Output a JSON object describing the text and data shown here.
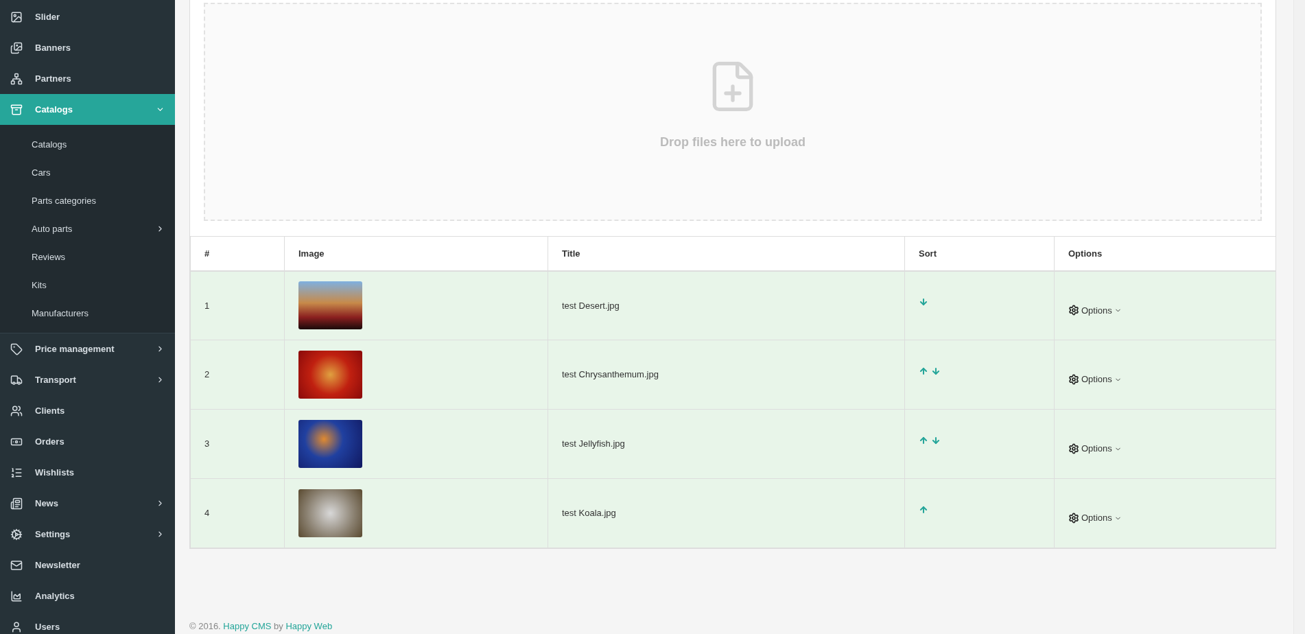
{
  "sidebar": {
    "items": [
      {
        "label": "Slider",
        "selected": false,
        "has_submenu": false
      },
      {
        "label": "Banners",
        "selected": false,
        "has_submenu": false
      },
      {
        "label": "Partners",
        "selected": false,
        "has_submenu": false
      },
      {
        "label": "Catalogs",
        "selected": true,
        "has_submenu": true,
        "expanded": true,
        "children": [
          {
            "label": "Catalogs",
            "has_submenu": false
          },
          {
            "label": "Cars",
            "has_submenu": false
          },
          {
            "label": "Parts categories",
            "has_submenu": false
          },
          {
            "label": "Auto parts",
            "has_submenu": true
          },
          {
            "label": "Reviews",
            "has_submenu": false
          },
          {
            "label": "Kits",
            "has_submenu": false
          },
          {
            "label": "Manufacturers",
            "has_submenu": false
          }
        ]
      },
      {
        "label": "Price management",
        "selected": false,
        "has_submenu": true
      },
      {
        "label": "Transport",
        "selected": false,
        "has_submenu": true
      },
      {
        "label": "Clients",
        "selected": false,
        "has_submenu": false
      },
      {
        "label": "Orders",
        "selected": false,
        "has_submenu": false
      },
      {
        "label": "Wishlists",
        "selected": false,
        "has_submenu": false
      },
      {
        "label": "News",
        "selected": false,
        "has_submenu": true
      },
      {
        "label": "Settings",
        "selected": false,
        "has_submenu": true
      },
      {
        "label": "Newsletter",
        "selected": false,
        "has_submenu": false
      },
      {
        "label": "Analytics",
        "selected": false,
        "has_submenu": false
      },
      {
        "label": "Users",
        "selected": false,
        "has_submenu": false
      }
    ]
  },
  "dropzone": {
    "message": "Drop files here to upload"
  },
  "table": {
    "columns": [
      "#",
      "Image",
      "Title",
      "Sort",
      "Options"
    ],
    "rows": [
      {
        "number": "1",
        "title": "test Desert.jpg",
        "sort_up": false,
        "sort_down": true,
        "options": "Options"
      },
      {
        "number": "2",
        "title": "test Chrysanthemum.jpg",
        "sort_up": true,
        "sort_down": true,
        "options": "Options"
      },
      {
        "number": "3",
        "title": "test Jellyfish.jpg",
        "sort_up": true,
        "sort_down": true,
        "options": "Options"
      },
      {
        "number": "4",
        "title": "test Koala.jpg",
        "sort_up": true,
        "sort_down": false,
        "options": "Options"
      }
    ]
  },
  "footer": {
    "copyright": "© 2016.",
    "cms_link": "Happy CMS",
    "by": "by",
    "author_link": "Happy Web"
  }
}
